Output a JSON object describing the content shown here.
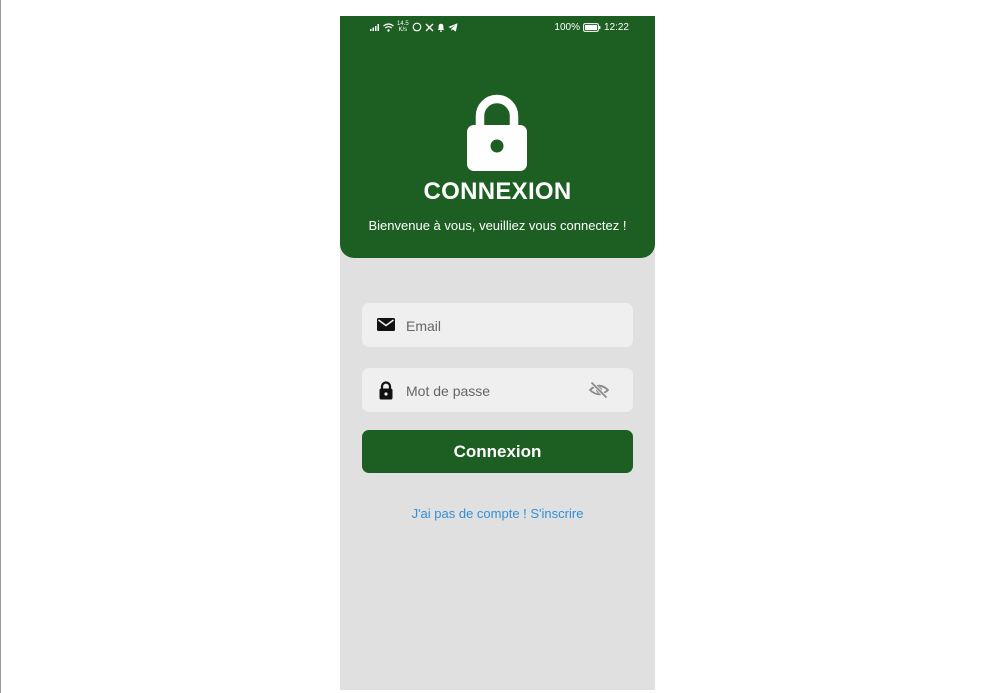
{
  "status_bar": {
    "net_speed_top": "14.5",
    "net_speed_bottom": "K/s",
    "battery": "100%",
    "time": "12:22"
  },
  "header": {
    "title": "CONNEXION",
    "subtitle": "Bienvenue à vous, veuilliez vous connectez !"
  },
  "form": {
    "email_placeholder": "Email",
    "password_placeholder": "Mot de passe",
    "submit_label": "Connexion",
    "signup_link": "J'ai pas de compte ! S'inscrire"
  },
  "icons": {
    "header": "lock-icon",
    "email": "envelope-icon",
    "password": "lock-icon",
    "visibility": "eye-off-icon"
  },
  "colors": {
    "primary": "#1d5e22",
    "background": "#e0e0e0",
    "field": "#efefef",
    "link": "#2f8fd8"
  }
}
